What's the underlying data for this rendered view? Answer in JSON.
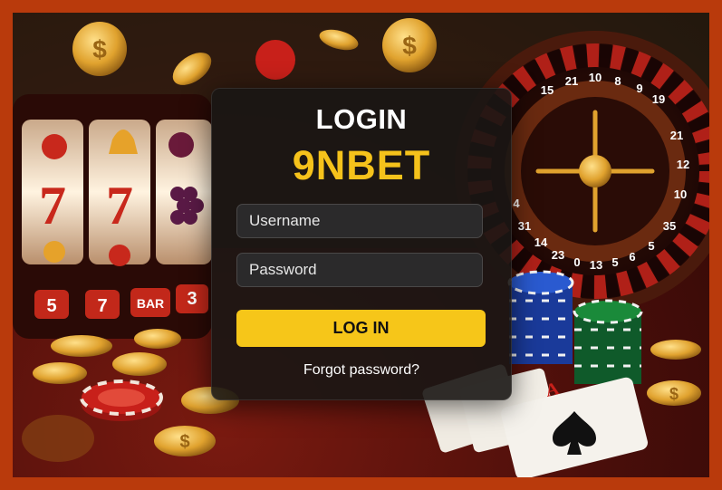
{
  "login": {
    "heading": "LOGIN",
    "brand": "9NBET",
    "username_placeholder": "Username",
    "password_placeholder": "Password",
    "submit_label": "LOG IN",
    "forgot_link": "Forgot password?"
  },
  "background": {
    "slot_reel_symbols": [
      "7",
      "7"
    ],
    "slot_panel_labels": [
      "5",
      "7",
      "BAR",
      "3"
    ],
    "roulette_numbers": [
      "15",
      "21",
      "10",
      "8",
      "9",
      "19",
      "21",
      "12",
      "10",
      "35",
      "5",
      "6",
      "5",
      "13",
      "0",
      "23",
      "14",
      "31",
      "4"
    ]
  },
  "colors": {
    "frame_border": "#b93a0c",
    "brand_yellow": "#f5c21b",
    "button_yellow": "#f6c619",
    "card_bg": "#1a1614",
    "felt_red": "#7a1a10",
    "gold": "#d9a232"
  },
  "icons": [
    "coin-icon",
    "casino-chip-icon",
    "playing-card-icon",
    "slot-machine-icon",
    "roulette-wheel-icon"
  ]
}
